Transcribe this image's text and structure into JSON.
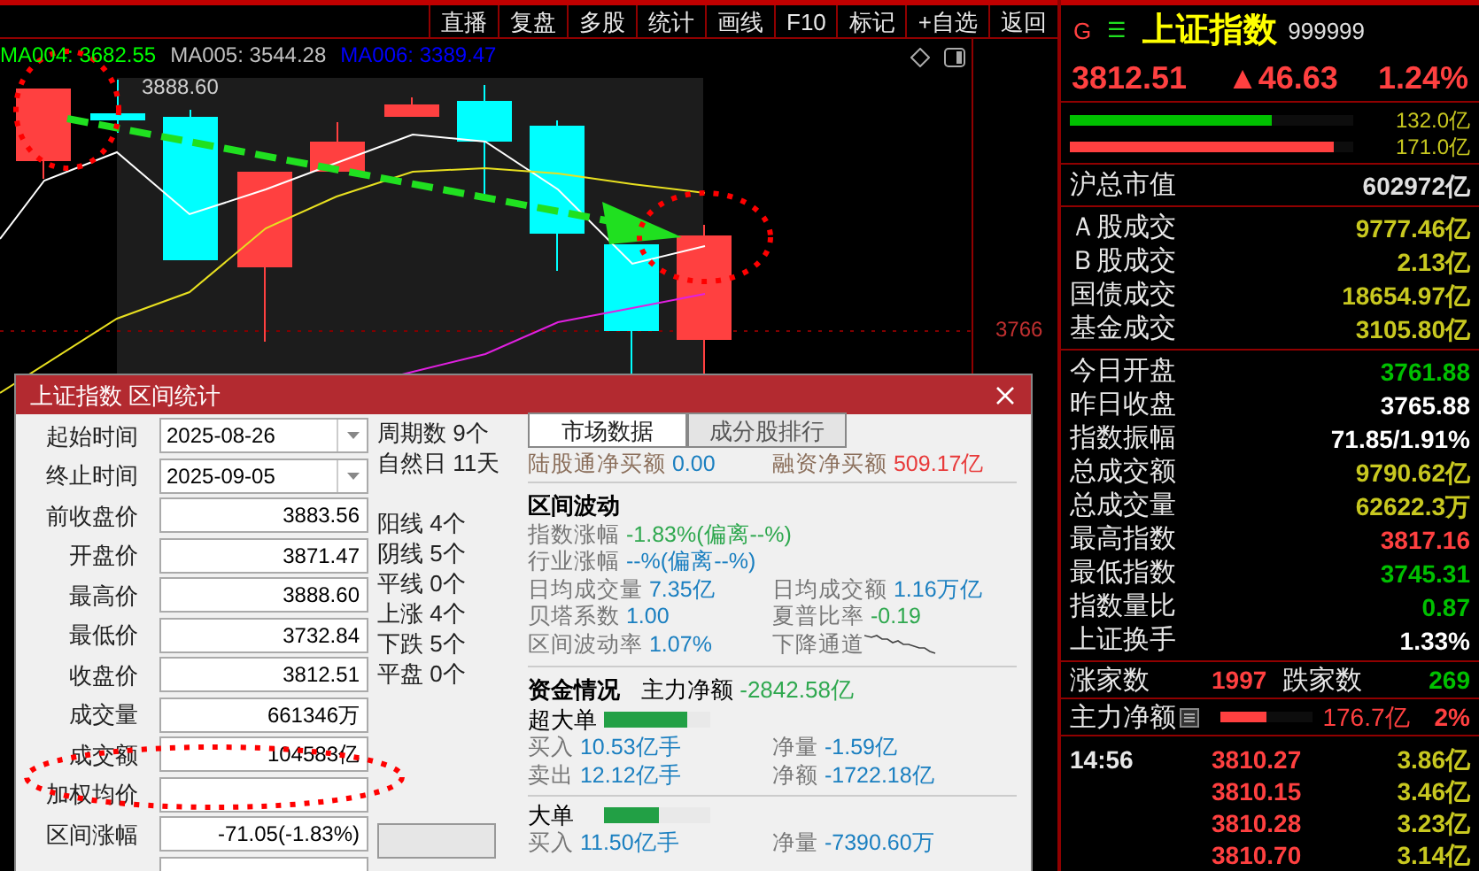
{
  "toolbar": [
    {
      "label": "直播"
    },
    {
      "label": "复盘"
    },
    {
      "label": "多股"
    },
    {
      "label": "统计"
    },
    {
      "label": "画线"
    },
    {
      "label": "F10"
    },
    {
      "label": "标记"
    },
    {
      "label": "+自选"
    },
    {
      "label": "返回"
    }
  ],
  "chart": {
    "ma_labels": [
      {
        "text": "MA004: 3682.55",
        "color": "#00ff00"
      },
      {
        "text": "MA005: 3544.28",
        "color": "#c0c0c0"
      },
      {
        "text": "MA006: 3389.47",
        "color": "#0000ff"
      }
    ],
    "high_label": "3888.60",
    "price_label": "3766"
  },
  "dialog": {
    "title": "上证指数 区间统计",
    "fields": [
      {
        "label": "起始时间",
        "value": "2025-08-26",
        "kind": "date"
      },
      {
        "label": "终止时间",
        "value": "2025-09-05",
        "kind": "date"
      },
      {
        "label": "前收盘价",
        "value": "3883.56",
        "kind": "text"
      },
      {
        "label": "开盘价",
        "value": "3871.47",
        "kind": "text"
      },
      {
        "label": "最高价",
        "value": "3888.60",
        "kind": "text"
      },
      {
        "label": "最低价",
        "value": "3732.84",
        "kind": "text"
      },
      {
        "label": "收盘价",
        "value": "3812.51",
        "kind": "text"
      },
      {
        "label": "成交量",
        "value": "661346万",
        "kind": "text"
      },
      {
        "label": "成交额",
        "value": "104583亿",
        "kind": "text"
      },
      {
        "label": "加权均价",
        "kind": "text"
      },
      {
        "label": "区间涨幅",
        "value": "-71.05(-1.83%)",
        "kind": "text"
      }
    ],
    "period": [
      "周期数 9个",
      "自然日 11天"
    ],
    "counts": [
      "阳线 4个",
      "阴线 5个",
      "平线 0个",
      "上涨 4个",
      "下跌 5个",
      "平盘 0个"
    ],
    "tabs": [
      {
        "label": "市场数据",
        "selected": true
      },
      {
        "label": "成分股排行",
        "selected": false
      }
    ],
    "flows": [
      {
        "label": "陆股通净买额",
        "value": "0.00",
        "color": "#1a7fc0"
      },
      {
        "label": "融资净买额",
        "value": "509.17亿",
        "color": "#e83a3a"
      }
    ],
    "volatility": {
      "title": "区间波动",
      "rows": [
        [
          {
            "label": "指数涨幅",
            "value": "-1.83%(偏离--%)",
            "color": "#2fa84f"
          }
        ],
        [
          {
            "label": "行业涨幅",
            "value": "--%(偏离--%)",
            "color": "#1a7fc0"
          }
        ],
        [
          {
            "label": "日均成交量",
            "value": "7.35亿",
            "color": "#1a7fc0"
          },
          {
            "label": "日均成交额",
            "value": "1.16万亿",
            "color": "#1a7fc0"
          }
        ],
        [
          {
            "label": "贝塔系数",
            "value": "1.00",
            "color": "#1a7fc0"
          },
          {
            "label": "夏普比率",
            "value": "-0.19",
            "color": "#2fa84f"
          }
        ],
        [
          {
            "label": "区间波动率",
            "value": "1.07%",
            "color": "#1a7fc0"
          },
          {
            "label": "下降通道",
            "kind": "trend"
          }
        ]
      ]
    },
    "funds": {
      "title": "资金情况",
      "net_label": "主力净额",
      "net_value": "-2842.58亿",
      "groups": [
        {
          "name": "超大单",
          "level": 0.78,
          "rows": [
            [
              {
                "label": "买入",
                "value": "10.53亿手"
              },
              {
                "label": "净量",
                "value": "-1.59亿"
              }
            ],
            [
              {
                "label": "卖出",
                "value": "12.12亿手"
              },
              {
                "label": "净额",
                "value": "-1722.18亿"
              }
            ]
          ]
        },
        {
          "name": "大单",
          "level": 0.52,
          "rows": [
            [
              {
                "label": "买入",
                "value": "11.50亿手"
              },
              {
                "label": "净量",
                "value": "-7390.60万"
              }
            ]
          ]
        }
      ]
    }
  },
  "quote": {
    "flag": "G",
    "menu": "☰",
    "name": "上证指数",
    "code": "999999",
    "price": "3812.51",
    "change": "▲46.63",
    "percent": "1.24%",
    "bars": [
      {
        "value": "132.0亿",
        "color": "#00c000",
        "level": 0.71
      },
      {
        "value": "171.0亿",
        "color": "#ff4040",
        "level": 0.93
      }
    ],
    "groups": [
      [
        {
          "label": "沪总市值",
          "value": "602972亿",
          "color": "#e0e0e0"
        }
      ],
      [
        {
          "label": "Ａ股成交",
          "value": "9777.46亿",
          "color": "#c8c820"
        },
        {
          "label": "Ｂ股成交",
          "value": "2.13亿",
          "color": "#c8c820"
        },
        {
          "label": "国债成交",
          "value": "18654.97亿",
          "color": "#c8c820"
        },
        {
          "label": "基金成交",
          "value": "3105.80亿",
          "color": "#c8c820"
        }
      ],
      [
        {
          "label": "今日开盘",
          "value": "3761.88",
          "color": "#00c000"
        },
        {
          "label": "昨日收盘",
          "value": "3765.88",
          "color": "#ffffff"
        },
        {
          "label": "指数振幅",
          "value": "71.85/1.91%",
          "color": "#ffffff"
        },
        {
          "label": "总成交额",
          "value": "9790.62亿",
          "color": "#c8c820"
        },
        {
          "label": "总成交量",
          "value": "62622.3万",
          "color": "#c8c820"
        },
        {
          "label": "最高指数",
          "value": "3817.16",
          "color": "#ff4040"
        },
        {
          "label": "最低指数",
          "value": "3745.31",
          "color": "#00c000"
        },
        {
          "label": "指数量比",
          "value": "0.87",
          "color": "#00c000"
        },
        {
          "label": "上证换手",
          "value": "1.33%",
          "color": "#ffffff"
        }
      ]
    ],
    "breadth": {
      "up_label": "涨家数",
      "up_value": "1997",
      "down_label": "跌家数",
      "down_value": "269"
    },
    "main_flow": {
      "label": "主力净额",
      "value": "176.7亿",
      "percent": "2%",
      "level": 0.5
    },
    "ticks": [
      {
        "time": "14:56",
        "price": "3810.27",
        "amount": "3.86亿"
      },
      {
        "price": "3810.15",
        "amount": "3.46亿"
      },
      {
        "price": "3810.28",
        "amount": "3.23亿"
      },
      {
        "price": "3810.70",
        "amount": "3.14亿"
      }
    ]
  }
}
